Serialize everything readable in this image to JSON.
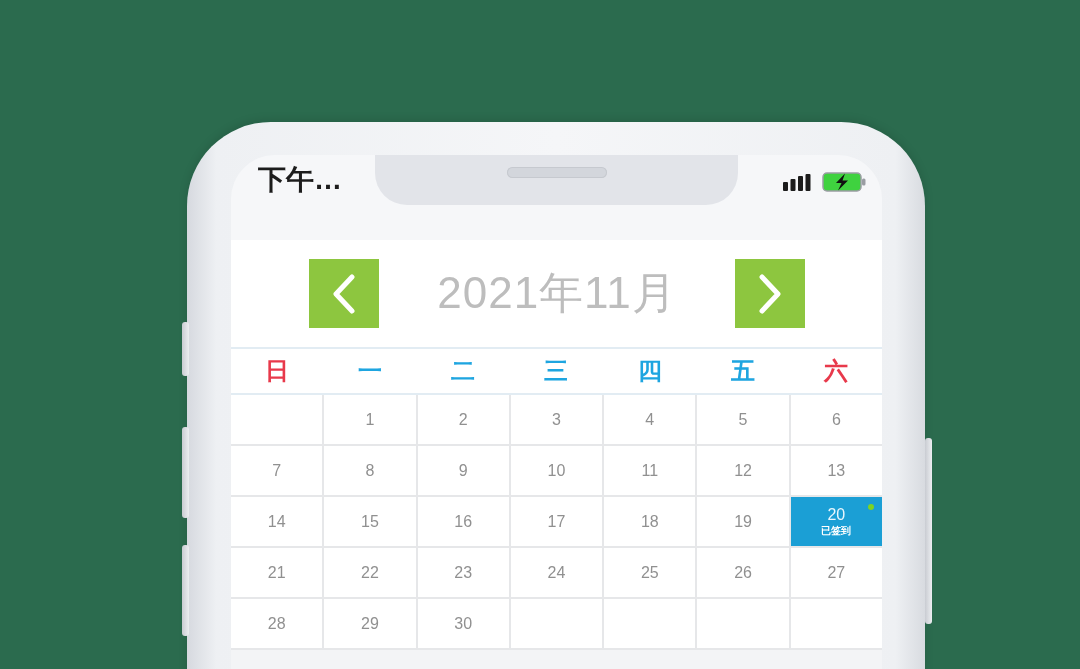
{
  "status_bar": {
    "time": "下午…"
  },
  "calendar": {
    "title": "2021年11月",
    "weekdays": [
      {
        "label": "日",
        "color": "#e8394b"
      },
      {
        "label": "一",
        "color": "#1ea5e0"
      },
      {
        "label": "二",
        "color": "#1ea5e0"
      },
      {
        "label": "三",
        "color": "#1ea5e0"
      },
      {
        "label": "四",
        "color": "#1ea5e0"
      },
      {
        "label": "五",
        "color": "#1ea5e0"
      },
      {
        "label": "六",
        "color": "#e8394b"
      }
    ],
    "days": [
      {
        "kind": "blank"
      },
      {
        "kind": "day",
        "label": "1",
        "selected": false,
        "event": false
      },
      {
        "kind": "day",
        "label": "2",
        "selected": false,
        "event": false
      },
      {
        "kind": "day",
        "label": "3",
        "selected": false,
        "event": false
      },
      {
        "kind": "day",
        "label": "4",
        "selected": false,
        "event": false
      },
      {
        "kind": "day",
        "label": "5",
        "selected": false,
        "event": false
      },
      {
        "kind": "day",
        "label": "6",
        "selected": false,
        "event": false
      },
      {
        "kind": "day",
        "label": "7",
        "selected": false,
        "event": false
      },
      {
        "kind": "day",
        "label": "8",
        "selected": false,
        "event": false
      },
      {
        "kind": "day",
        "label": "9",
        "selected": false,
        "event": false
      },
      {
        "kind": "day",
        "label": "10",
        "selected": false,
        "event": false
      },
      {
        "kind": "day",
        "label": "11",
        "selected": false,
        "event": false
      },
      {
        "kind": "day",
        "label": "12",
        "selected": false,
        "event": false
      },
      {
        "kind": "day",
        "label": "13",
        "selected": false,
        "event": false
      },
      {
        "kind": "day",
        "label": "14",
        "selected": false,
        "event": false
      },
      {
        "kind": "day",
        "label": "15",
        "selected": false,
        "event": false
      },
      {
        "kind": "day",
        "label": "16",
        "selected": false,
        "event": false
      },
      {
        "kind": "day",
        "label": "17",
        "selected": false,
        "event": false
      },
      {
        "kind": "day",
        "label": "18",
        "selected": false,
        "event": false
      },
      {
        "kind": "day",
        "label": "19",
        "selected": false,
        "event": false
      },
      {
        "kind": "day",
        "label": "20",
        "selected": true,
        "event": true,
        "note": "已签到"
      },
      {
        "kind": "day",
        "label": "21",
        "selected": false,
        "event": false
      },
      {
        "kind": "day",
        "label": "22",
        "selected": false,
        "event": false
      },
      {
        "kind": "day",
        "label": "23",
        "selected": false,
        "event": false
      },
      {
        "kind": "day",
        "label": "24",
        "selected": false,
        "event": false
      },
      {
        "kind": "day",
        "label": "25",
        "selected": false,
        "event": false
      },
      {
        "kind": "day",
        "label": "26",
        "selected": false,
        "event": false
      },
      {
        "kind": "day",
        "label": "27",
        "selected": false,
        "event": false
      },
      {
        "kind": "day",
        "label": "28",
        "selected": false,
        "event": false
      },
      {
        "kind": "day",
        "label": "29",
        "selected": false,
        "event": false
      },
      {
        "kind": "day",
        "label": "30",
        "selected": false,
        "event": false
      },
      {
        "kind": "blank"
      },
      {
        "kind": "blank"
      },
      {
        "kind": "blank"
      },
      {
        "kind": "blank"
      }
    ]
  }
}
